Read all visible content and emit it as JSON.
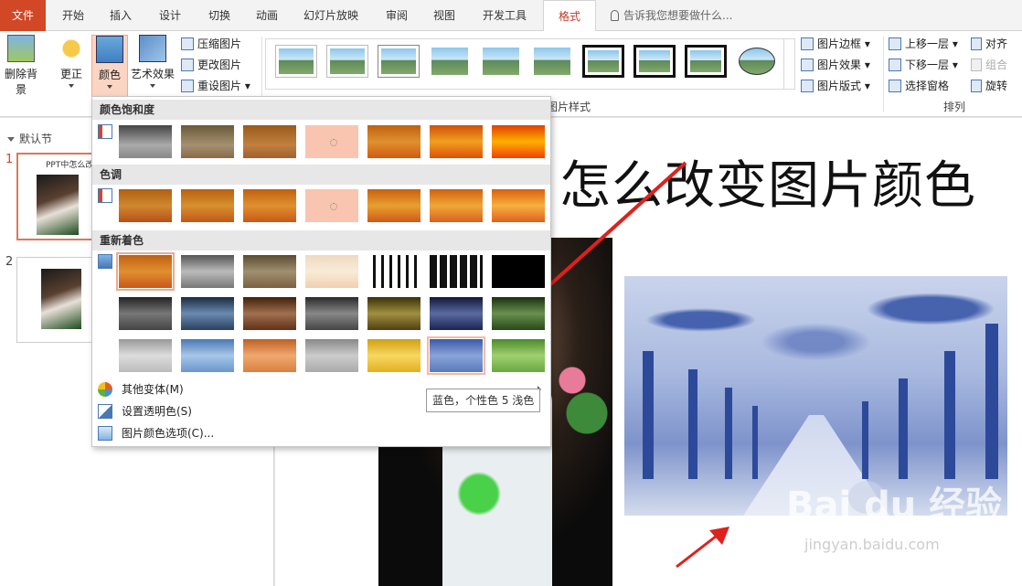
{
  "tabs": [
    "文件",
    "开始",
    "插入",
    "设计",
    "切换",
    "动画",
    "幻灯片放映",
    "审阅",
    "视图",
    "开发工具",
    "格式"
  ],
  "tell_me": "告诉我您想要做什么...",
  "ribbon": {
    "remove_bg": "删除背景",
    "corrections": "更正",
    "color": "颜色",
    "artistic": "艺术效果",
    "compress": "压缩图片",
    "change": "更改图片",
    "reset": "重设图片",
    "styles_group": "图片样式",
    "border": "图片边框",
    "effects": "图片效果",
    "layout": "图片版式",
    "bring_forward": "上移一层",
    "send_backward": "下移一层",
    "selection_pane": "选择窗格",
    "align": "对齐",
    "group": "组合",
    "rotate": "旋转",
    "arrange_group": "排列"
  },
  "pane": {
    "section": "默认节",
    "slide1_num": "1",
    "slide1_title": "PPT中怎么改",
    "slide2_num": "2"
  },
  "slide": {
    "title": "怎么改变图片颜色"
  },
  "dropdown": {
    "saturation_header": "颜色饱和度",
    "tone_header": "色调",
    "recolor_header": "重新着色",
    "more_variations": "其他变体(M)",
    "set_transparent": "设置透明色(S)",
    "color_options": "图片颜色选项(C)..."
  },
  "tooltip": "蓝色，个性色 5 浅色",
  "watermark": "Bai du 经验",
  "watermark_url": "jingyan.baidu.com",
  "colors": {
    "file_tab": "#d24726",
    "accent": "#c0392b",
    "selected_btn": "#fbd5c4",
    "arrow_red": "#e0201b"
  }
}
